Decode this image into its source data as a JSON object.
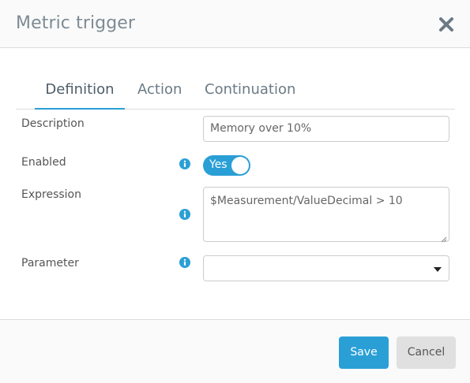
{
  "dialog": {
    "title": "Metric trigger",
    "close_icon": "close-icon"
  },
  "tabs": [
    {
      "label": "Definition",
      "active": true
    },
    {
      "label": "Action",
      "active": false
    },
    {
      "label": "Continuation",
      "active": false
    }
  ],
  "form": {
    "description": {
      "label": "Description",
      "value": "Memory over 10%"
    },
    "enabled": {
      "label": "Enabled",
      "toggle_text": "Yes",
      "on": true,
      "info_icon": "info-icon"
    },
    "expression": {
      "label": "Expression",
      "value": "$Measurement/ValueDecimal > 10",
      "info_icon": "info-icon"
    },
    "parameter": {
      "label": "Parameter",
      "value": "",
      "info_icon": "info-icon"
    }
  },
  "footer": {
    "save_label": "Save",
    "cancel_label": "Cancel"
  },
  "colors": {
    "accent": "#2a9fd6",
    "title": "#7d8b95",
    "cancel_bg": "#e0e0e0"
  }
}
